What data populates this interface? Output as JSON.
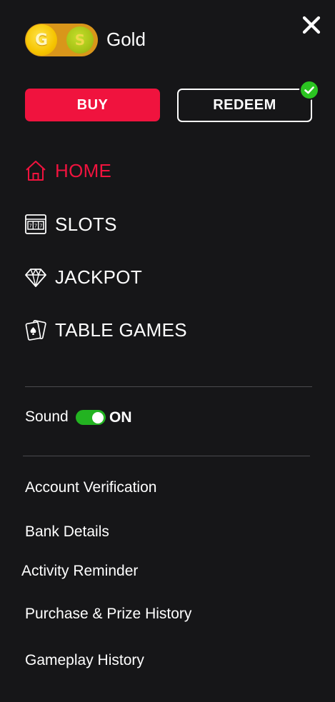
{
  "header": {
    "close_icon": "close-icon",
    "currency": {
      "gold_coin_letter": "G",
      "sweeps_coin_letter": "S",
      "label": "Gold"
    }
  },
  "actions": {
    "buy_label": "BUY",
    "redeem_label": "REDEEM",
    "redeem_badge_icon": "check-icon"
  },
  "nav": {
    "items": [
      {
        "label": "HOME",
        "icon": "home-icon",
        "active": true
      },
      {
        "label": "SLOTS",
        "icon": "slot-machine-icon",
        "active": false
      },
      {
        "label": "JACKPOT",
        "icon": "diamond-icon",
        "active": false
      },
      {
        "label": "TABLE GAMES",
        "icon": "playing-cards-icon",
        "active": false
      }
    ]
  },
  "settings": {
    "sound_label": "Sound",
    "sound_state": "ON",
    "sound_on": true
  },
  "links": [
    "Account Verification",
    "Bank Details",
    "Activity Reminder",
    "Purchase & Prize History",
    "Gameplay History"
  ],
  "colors": {
    "background": "#161618",
    "accent_red": "#f0133e",
    "toggle_green": "#23b321",
    "check_green": "#2bc421"
  }
}
